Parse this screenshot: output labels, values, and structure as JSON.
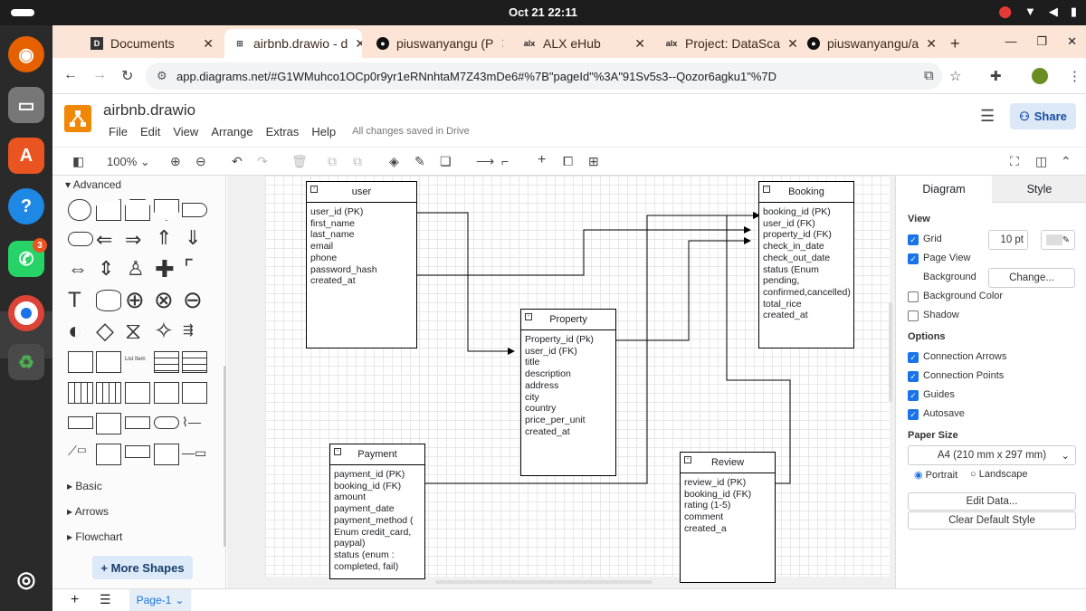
{
  "system": {
    "clock": "Oct 21  22:11"
  },
  "dock": {
    "whatsapp_badge": "3"
  },
  "browser": {
    "tabs": [
      {
        "label": "Documents",
        "icon": "docs-icon"
      },
      {
        "label": "airbnb.drawio - d",
        "icon": "drawio-icon"
      },
      {
        "label": "piuswanyangu (P",
        "icon": "github-icon"
      },
      {
        "label": "ALX eHub",
        "icon": "alx-icon"
      },
      {
        "label": "Project: DataSca",
        "icon": "alx-icon"
      },
      {
        "label": "piuswanyangu/a",
        "icon": "github-icon"
      }
    ],
    "url": "app.diagrams.net/#G1WMuhco1OCp0r9yr1eRNnhtaM7Z43mDe6#%7B\"pageId\"%3A\"91Sv5s3--Qozor6agku1\"%7D"
  },
  "drawio": {
    "file_title": "airbnb.drawio",
    "menu": [
      "File",
      "Edit",
      "View",
      "Arrange",
      "Extras",
      "Help"
    ],
    "save_status": "All changes saved in Drive",
    "share_label": "Share",
    "zoom": "100%",
    "sidebar": {
      "advanced": "Advanced",
      "basic": "Basic",
      "arrows": "Arrows",
      "flowchart": "Flowchart",
      "more_shapes": "More Shapes",
      "list_item_text": "List Item"
    },
    "entities": {
      "user": {
        "title": "user",
        "fields": [
          "user_id  (PK)",
          "first_name",
          "last_name",
          "email",
          "phone",
          "password_hash",
          "created_at"
        ]
      },
      "booking": {
        "title": "Booking",
        "fields": [
          "booking_id (PK)",
          "user_id  (FK)",
          "property_id (FK)",
          "check_in_date",
          "check_out_date",
          "status (Enum",
          "pending,",
          "confirmed,cancelled)",
          "total_rice",
          "created_at"
        ]
      },
      "property": {
        "title": "Property",
        "fields": [
          "Property_id  (Pk)",
          "user_id  (FK)",
          "title",
          "description",
          "address",
          "city",
          "country",
          "price_per_unit",
          "created_at"
        ]
      },
      "payment": {
        "title": "Payment",
        "fields": [
          "payment_id (PK)",
          "booking_id (FK)",
          "amount",
          "payment_date",
          "payment_method (",
          "Enum credit_card,",
          "paypal)",
          "status (enum :",
          "completed, fail)"
        ]
      },
      "review": {
        "title": "Review",
        "fields": [
          "review_id (PK)",
          "booking_id (FK)",
          "rating (1-5)",
          "comment",
          "created_a"
        ]
      }
    },
    "panel": {
      "tab_diagram": "Diagram",
      "tab_style": "Style",
      "view": "View",
      "grid": "Grid",
      "grid_size": "10 pt",
      "page_view": "Page View",
      "background": "Background",
      "change": "Change...",
      "background_color": "Background Color",
      "shadow": "Shadow",
      "options": "Options",
      "connection_arrows": "Connection Arrows",
      "connection_points": "Connection Points",
      "guides": "Guides",
      "autosave": "Autosave",
      "paper_size": "Paper Size",
      "paper_value": "A4 (210 mm x 297 mm)",
      "portrait": "Portrait",
      "landscape": "Landscape",
      "edit_data": "Edit Data...",
      "clear_style": "Clear Default Style",
      "checks": {
        "grid": true,
        "page_view": true,
        "background_color": false,
        "shadow": false,
        "connection_arrows": true,
        "connection_points": true,
        "guides": true,
        "autosave": true
      }
    },
    "page_tab": "Page-1"
  }
}
